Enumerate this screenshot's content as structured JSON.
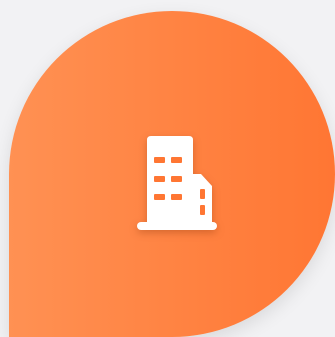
{
  "tile": {
    "icon": "office-building-icon",
    "gradient_start": "#ff9153",
    "gradient_end": "#ff7633",
    "icon_color": "#ffffff",
    "background_color": "#f2f2f4"
  }
}
